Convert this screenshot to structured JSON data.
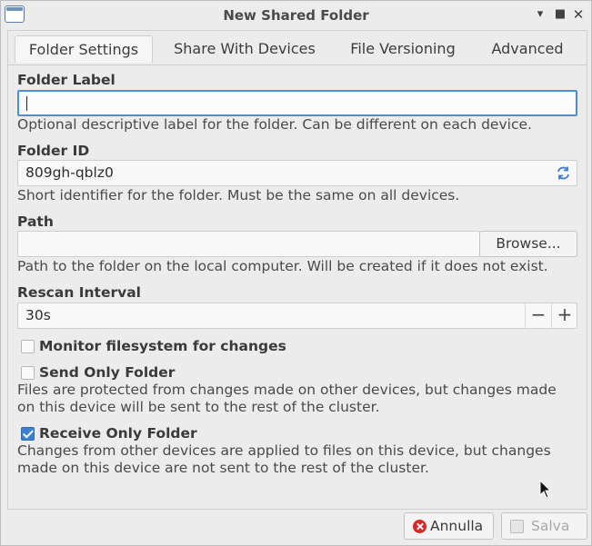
{
  "window": {
    "title": "New Shared Folder"
  },
  "tabs": [
    {
      "label": "Folder Settings",
      "active": true
    },
    {
      "label": "Share With Devices",
      "active": false
    },
    {
      "label": "File Versioning",
      "active": false
    },
    {
      "label": "Advanced",
      "active": false
    }
  ],
  "folder_label": {
    "label": "Folder Label",
    "value": "",
    "help": "Optional descriptive label for the folder. Can be different on each device."
  },
  "folder_id": {
    "label": "Folder ID",
    "value": "809gh-qblz0",
    "help": "Short identifier for the folder. Must be the same on all devices.",
    "icon": "refresh-icon"
  },
  "path": {
    "label": "Path",
    "value": "",
    "browse_label": "Browse...",
    "help": "Path to the folder on the local computer. Will be created if it does not exist."
  },
  "rescan": {
    "label": "Rescan Interval",
    "value": "30s",
    "decrement": "−",
    "increment": "+"
  },
  "options": {
    "monitor": {
      "label": "Monitor filesystem for changes",
      "checked": false
    },
    "send_only": {
      "label": "Send Only Folder",
      "checked": false,
      "help_line1": "Files are protected from changes made on other devices, but changes made",
      "help_line2": "on this device will be sent to the rest of the cluster."
    },
    "receive_only": {
      "label": "Receive Only Folder",
      "checked": true,
      "help_line1": "Changes from other devices are applied to files on this device, but changes",
      "help_line2": "made on this device are not sent to the rest of the cluster."
    }
  },
  "footer": {
    "cancel_label": "Annulla",
    "save_label": "Salva",
    "save_disabled": true
  },
  "colors": {
    "accent": "#4a90d9",
    "checkbox_checked": "#3d7fd0",
    "cancel_icon": "#d62a2a"
  }
}
